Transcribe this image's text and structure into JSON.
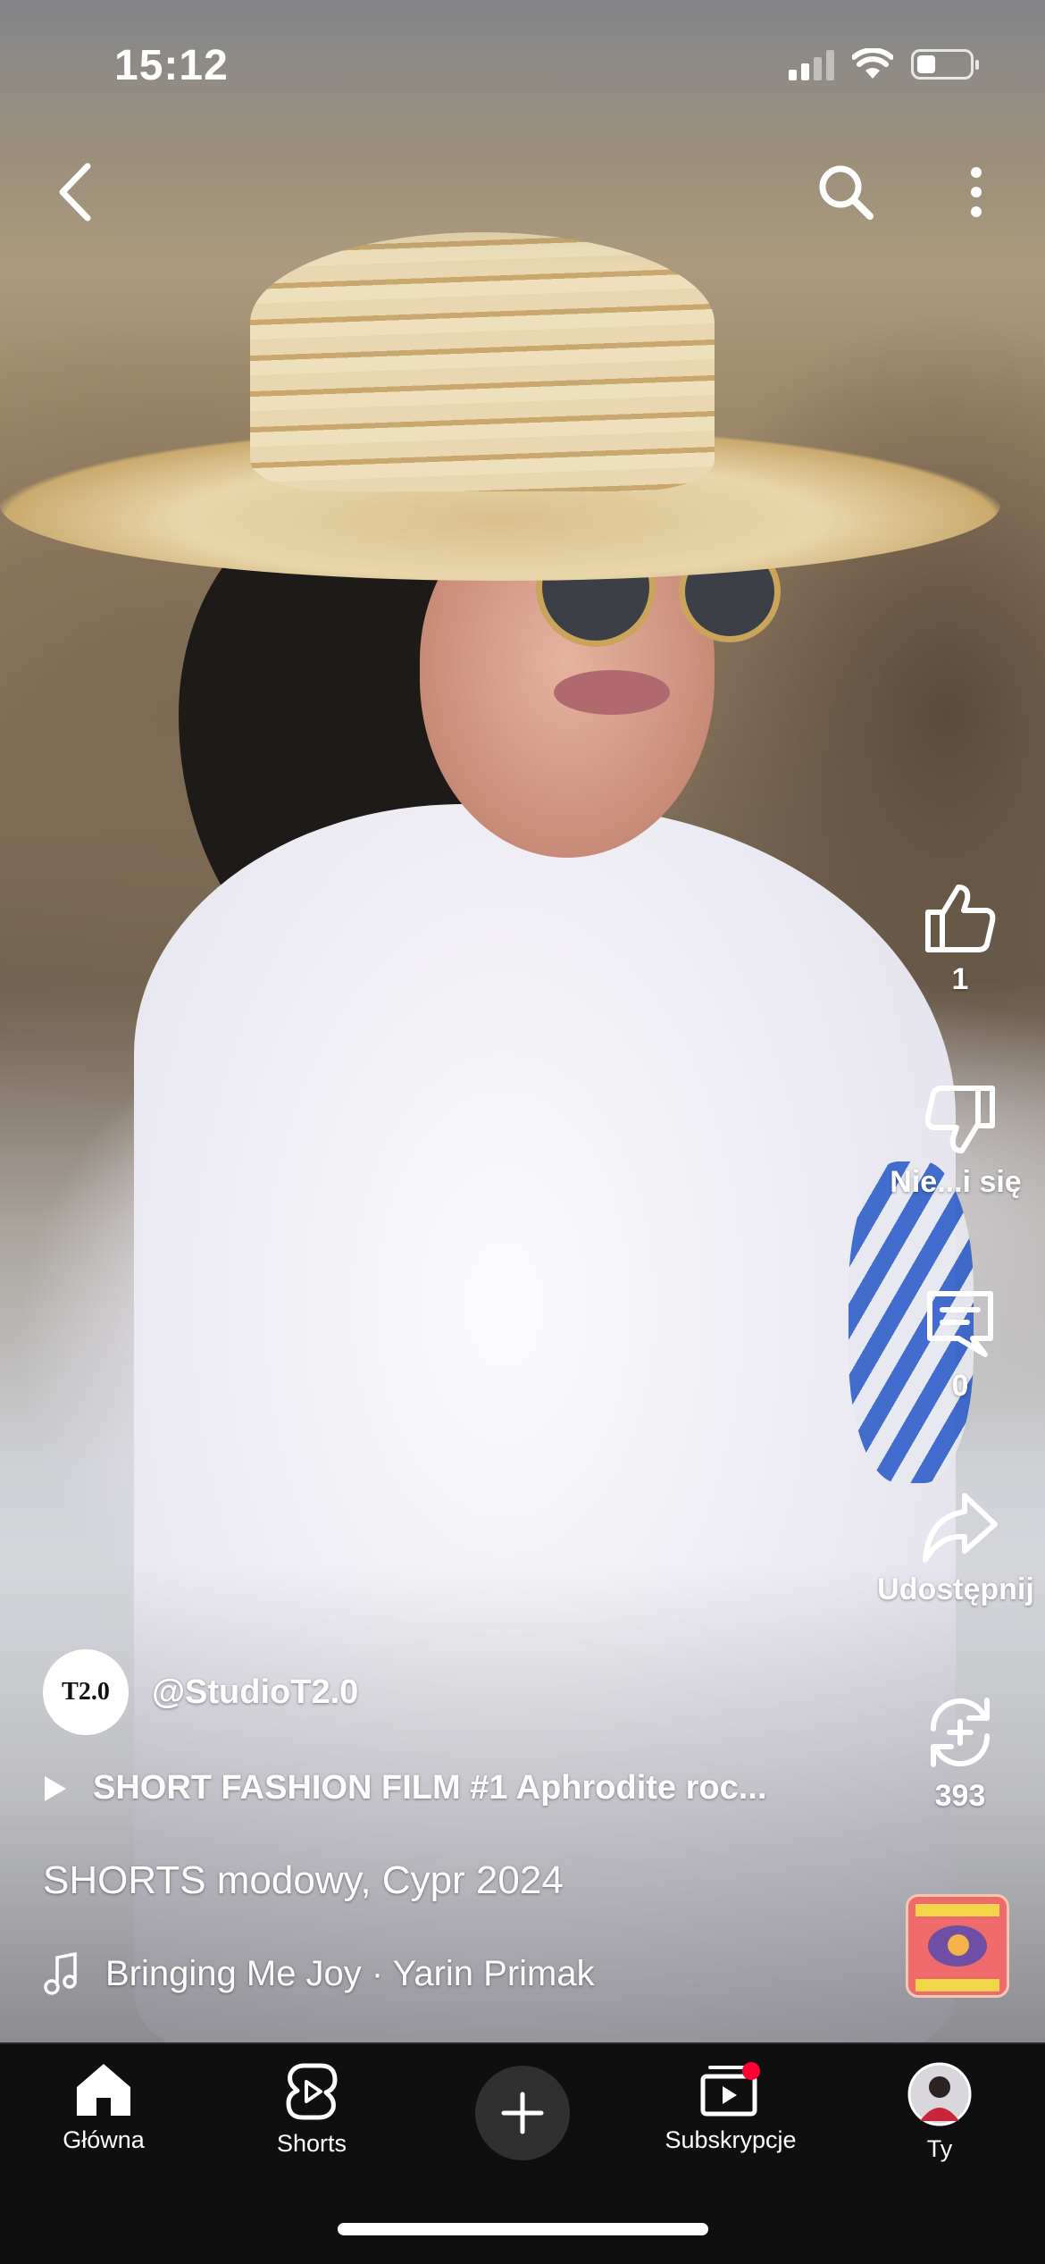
{
  "status_bar": {
    "time": "15:12",
    "signal_bars": 4,
    "signal_active": 2,
    "battery_level": 0.35
  },
  "top_bar": {
    "back_icon": "chevron-left-icon",
    "search_icon": "search-icon",
    "menu_icon": "more-vertical-icon"
  },
  "actions": {
    "like_count": "1",
    "dislike_label": "Nie...i się",
    "comment_count": "0",
    "share_label": "Udostępnij",
    "remix_count": "393"
  },
  "channel": {
    "avatar_text": "T2.0",
    "handle": "@StudioT2.0"
  },
  "related_video": {
    "title": "SHORT FASHION FILM #1 Aphrodite roc..."
  },
  "description": "SHORTS modowy, Cypr 2024",
  "music": {
    "track": "Bringing Me Joy · Yarin Primak"
  },
  "nav": {
    "items": [
      {
        "label": "Główna",
        "icon": "home-icon"
      },
      {
        "label": "Shorts",
        "icon": "shorts-icon"
      },
      {
        "label": "",
        "icon": "plus-icon"
      },
      {
        "label": "Subskrypcje",
        "icon": "subscriptions-icon"
      },
      {
        "label": "Ty",
        "icon": "profile-avatar"
      }
    ],
    "notification_color": "#ff0033"
  }
}
